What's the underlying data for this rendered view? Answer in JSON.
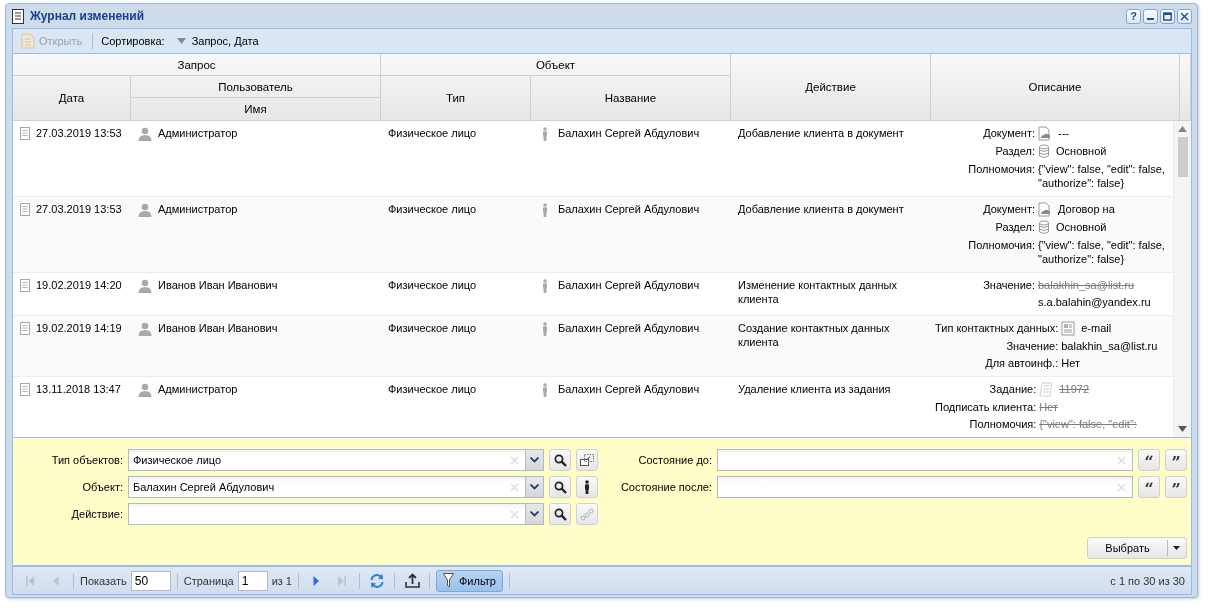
{
  "window": {
    "title": "Журнал изменений",
    "help": "?"
  },
  "toolbar": {
    "open": {
      "label": "Открыть",
      "disabled": true
    },
    "sort_label": "Сортировка:",
    "sort_value": "Запрос, Дата"
  },
  "table": {
    "columns": {
      "request": "Запрос",
      "date": "Дата",
      "user": "Пользователь",
      "name": "Имя",
      "object": "Объект",
      "type": "Тип",
      "title": "Название",
      "action": "Действие",
      "description": "Описание"
    },
    "rows": [
      {
        "date": "27.03.2019 13:53",
        "user": "Администратор",
        "object_type": "Физическое лицо",
        "object_name": "Балахин Сергей Абдулович",
        "action": "Добавление клиента в документ",
        "details": [
          {
            "label": "Документ:",
            "kind": "document",
            "values": [
              {
                "text": "---",
                "struck": false
              }
            ]
          },
          {
            "label": "Раздел:",
            "kind": "database",
            "values": [
              {
                "text": "Основной",
                "struck": false
              }
            ]
          },
          {
            "label": "Полномочия:",
            "values": [
              {
                "text": "{\"view\": false, \"edit\": false, \"authorize\": false}",
                "struck": false
              }
            ]
          }
        ]
      },
      {
        "date": "27.03.2019 13:53",
        "user": "Администратор",
        "object_type": "Физическое лицо",
        "object_name": "Балахин Сергей Абдулович",
        "action": "Добавление клиента в документ",
        "details": [
          {
            "label": "Документ:",
            "kind": "document",
            "values": [
              {
                "text": "Договор на",
                "struck": false
              }
            ]
          },
          {
            "label": "Раздел:",
            "kind": "database",
            "values": [
              {
                "text": "Основной",
                "struck": false
              }
            ]
          },
          {
            "label": "Полномочия:",
            "values": [
              {
                "text": "{\"view\": false, \"edit\": false, \"authorize\": false}",
                "struck": false
              }
            ]
          }
        ]
      },
      {
        "date": "19.02.2019 14:20",
        "user": "Иванов Иван Иванович",
        "object_type": "Физическое лицо",
        "object_name": "Балахин Сергей Абдулович",
        "action": "Изменение контактных данных клиента",
        "details": [
          {
            "label": "Значение:",
            "values": [
              {
                "text": "balakhin_sa@list.ru",
                "struck": true
              },
              {
                "text": "s.a.balahin@yandex.ru",
                "struck": false
              }
            ]
          }
        ]
      },
      {
        "date": "19.02.2019 14:19",
        "user": "Иванов Иван Иванович",
        "object_type": "Физическое лицо",
        "object_name": "Балахин Сергей Абдулович",
        "action": "Создание контактных данных клиента",
        "details": [
          {
            "label": "Тип контактных данных:",
            "kind": "contact",
            "values": [
              {
                "text": "e-mail",
                "struck": false
              }
            ]
          },
          {
            "label": "Значение:",
            "values": [
              {
                "text": "balakhin_sa@list.ru",
                "struck": false
              }
            ]
          },
          {
            "label": "Для автоинф.:",
            "values": [
              {
                "text": "Нет",
                "struck": false
              }
            ]
          }
        ]
      },
      {
        "date": "13.11.2018 13:47",
        "user": "Администратор",
        "object_type": "Физическое лицо",
        "object_name": "Балахин Сергей Абдулович",
        "action": "Удаление клиента из задания",
        "details": [
          {
            "label": "Задание:",
            "kind": "task",
            "values": [
              {
                "text": "11972",
                "struck": true
              }
            ]
          },
          {
            "label": "Подписать клиента:",
            "values": [
              {
                "text": "Нет",
                "struck": true
              }
            ]
          },
          {
            "label": "Полномочия:",
            "values": [
              {
                "text": "{\"view\": false, \"edit\":",
                "struck": true
              }
            ]
          }
        ]
      }
    ]
  },
  "filters": {
    "left": [
      {
        "label": "Тип объектов:",
        "value": "Физическое лицо",
        "extra": {
          "kind": "select",
          "disabled": false
        }
      },
      {
        "label": "Объект:",
        "value": "Балахин Сергей Абдулович",
        "extra": {
          "kind": "person",
          "disabled": false
        }
      },
      {
        "label": "Действие:",
        "extra": {
          "kind": "chain",
          "disabled": true
        }
      }
    ],
    "right": [
      {
        "label": "Состояние до:",
        "buttons": [
          "“",
          "”"
        ]
      },
      {
        "label": "Состояние после:",
        "buttons": [
          "“",
          "”"
        ]
      }
    ],
    "select_button": "Выбрать"
  },
  "paging": {
    "nav": [
      {
        "kind": "first",
        "disabled": true
      },
      {
        "kind": "prev",
        "disabled": true
      },
      {
        "kind": "next",
        "disabled": false
      },
      {
        "kind": "last",
        "disabled": true
      }
    ],
    "show_label": "Показать",
    "page_size": "50",
    "page_label": "Страница",
    "page": "1",
    "of": "из 1",
    "filter": {
      "label": "Фильтр",
      "selected": true
    },
    "summary": "с 1 по 30 из 30"
  }
}
